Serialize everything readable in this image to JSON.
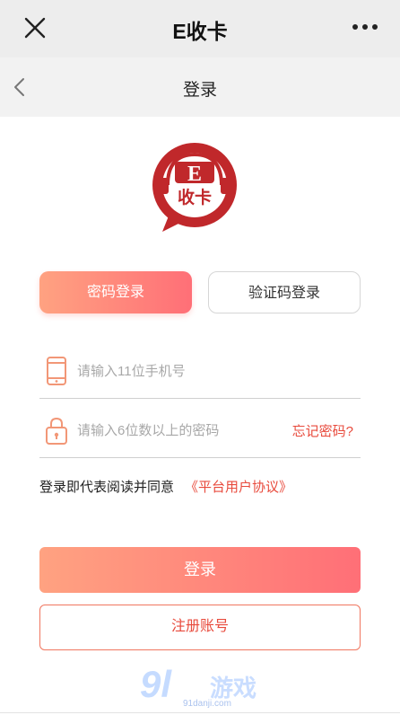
{
  "app": {
    "title": "E收卡"
  },
  "nav": {
    "title": "登录"
  },
  "logo": {
    "text_e": "E",
    "text_main": "收卡"
  },
  "tabs": [
    {
      "label": "密码登录",
      "active": true
    },
    {
      "label": "验证码登录",
      "active": false
    }
  ],
  "phone": {
    "placeholder": "请输入11位手机号",
    "value": ""
  },
  "password": {
    "placeholder": "请输入6位数以上的密码",
    "value": ""
  },
  "forgot_label": "忘记密码?",
  "agreement": {
    "text": "登录即代表阅读并同意",
    "link": "《平台用户协议》"
  },
  "login_label": "登录",
  "register_label": "注册账号",
  "watermark": {
    "num": "9l",
    "text": "游戏",
    "url": "91danji.com"
  },
  "colors": {
    "accent_start": "#ffa281",
    "accent_end": "#ff6f77",
    "link_red": "#e84a3c",
    "logo_red": "#c0282b"
  },
  "icons": [
    "close-icon",
    "more-icon",
    "back-chevron-icon",
    "phone-icon",
    "lock-icon"
  ]
}
